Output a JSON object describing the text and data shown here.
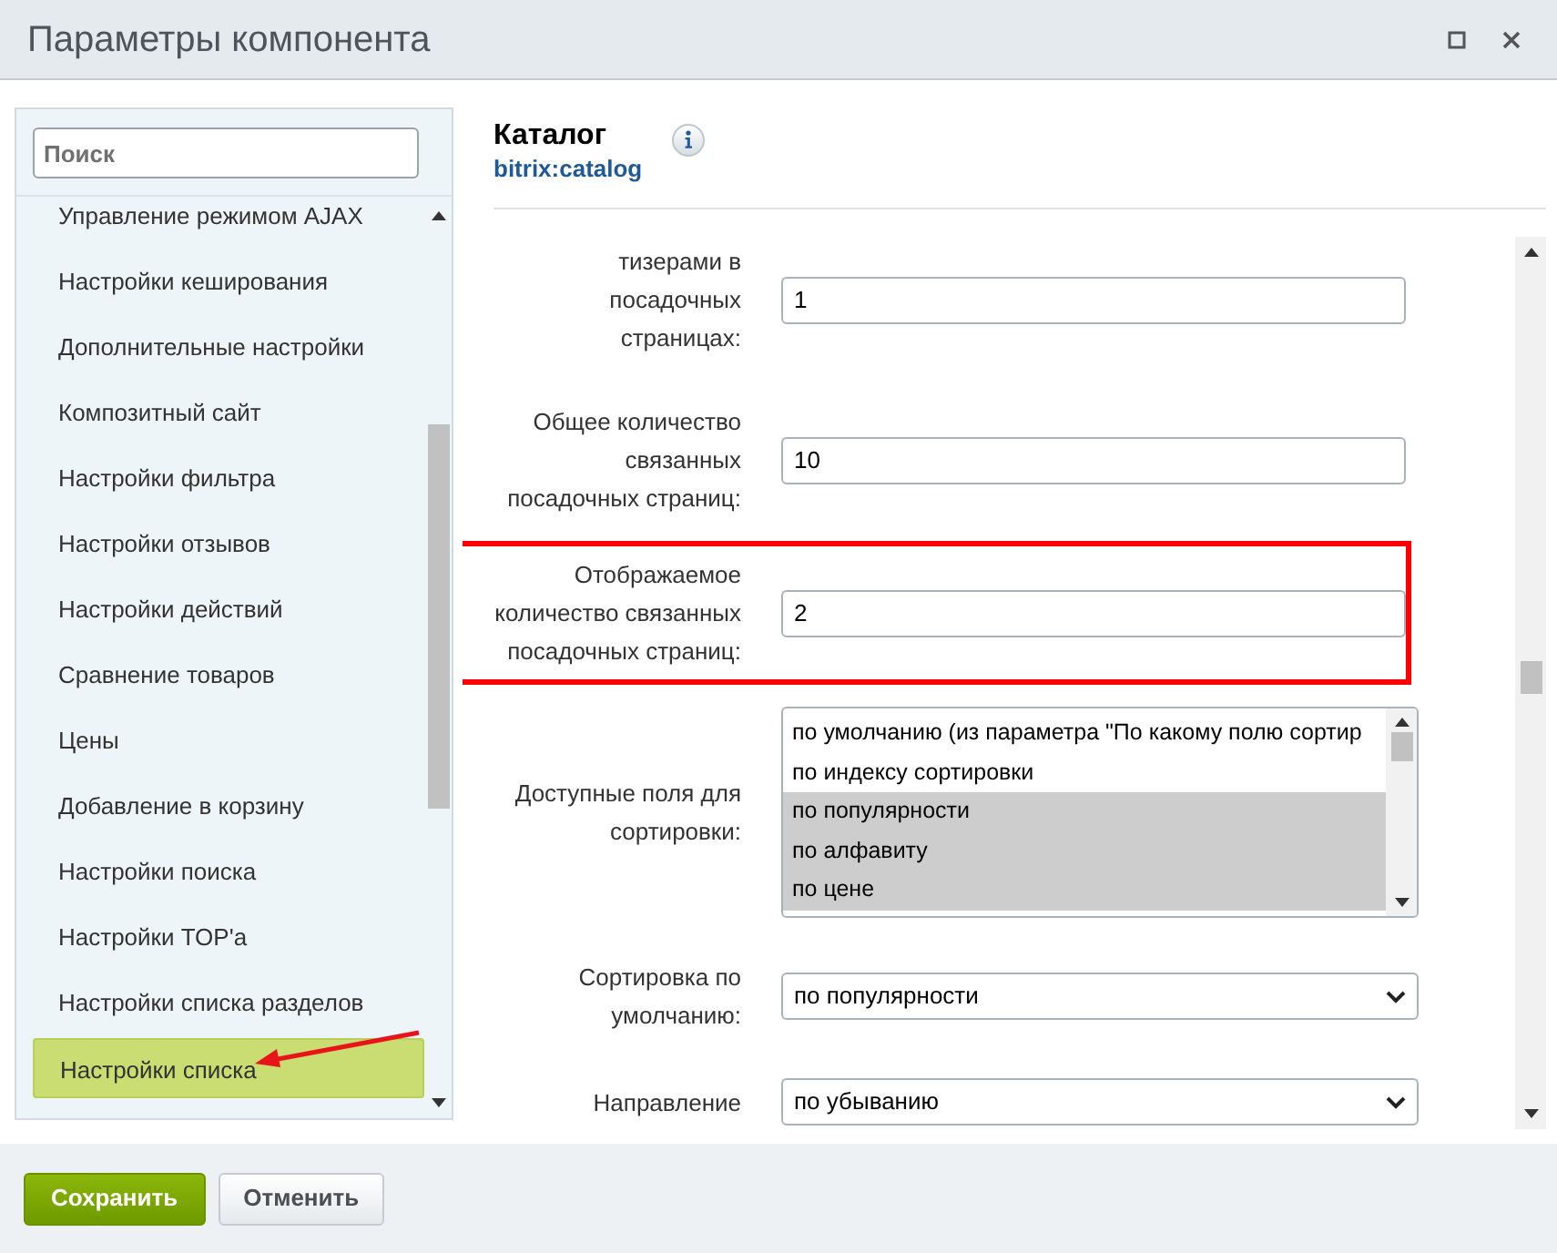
{
  "window": {
    "title": "Параметры компонента"
  },
  "sidebar": {
    "search": {
      "placeholder": "Поиск"
    },
    "items": [
      {
        "label": "Управление режимом AJAX",
        "selected": false
      },
      {
        "label": "Настройки кеширования",
        "selected": false
      },
      {
        "label": "Дополнительные настройки",
        "selected": false
      },
      {
        "label": "Композитный сайт",
        "selected": false
      },
      {
        "label": "Настройки фильтра",
        "selected": false
      },
      {
        "label": "Настройки отзывов",
        "selected": false
      },
      {
        "label": "Настройки действий",
        "selected": false
      },
      {
        "label": "Сравнение товаров",
        "selected": false
      },
      {
        "label": "Цены",
        "selected": false
      },
      {
        "label": "Добавление в корзину",
        "selected": false
      },
      {
        "label": "Настройки поиска",
        "selected": false
      },
      {
        "label": "Настройки TOP'а",
        "selected": false
      },
      {
        "label": "Настройки списка разделов",
        "selected": false
      },
      {
        "label": "Настройки списка",
        "selected": true
      }
    ]
  },
  "component": {
    "title": "Каталог",
    "code": "bitrix:catalog"
  },
  "fields": [
    {
      "kind": "text",
      "label": "тизерами в посадочных страницах:",
      "value": "1",
      "highlighted": false
    },
    {
      "kind": "text",
      "label": "Общее количество связанных посадочных страниц:",
      "value": "10",
      "highlighted": false
    },
    {
      "kind": "text",
      "label": "Отображаемое количество связанных посадочных страниц:",
      "value": "2",
      "highlighted": true
    },
    {
      "kind": "multiselect",
      "label": "Доступные поля для сортировки:",
      "highlighted": false,
      "options": [
        {
          "label": "по умолчанию (из параметра \"По какому полю сортир",
          "selected": false
        },
        {
          "label": "по индексу сортировки",
          "selected": false
        },
        {
          "label": "по популярности",
          "selected": true
        },
        {
          "label": "по алфавиту",
          "selected": true
        },
        {
          "label": "по цене",
          "selected": true
        }
      ]
    },
    {
      "kind": "select",
      "label": "Сортировка по умолчанию:",
      "value": "по популярности",
      "highlighted": false
    },
    {
      "kind": "select",
      "label": "Направление",
      "value": "по убыванию",
      "highlighted": false
    }
  ],
  "buttons": [
    {
      "label": "Сохранить",
      "kind": "primary"
    },
    {
      "label": "Отменить",
      "kind": "secondary"
    }
  ]
}
